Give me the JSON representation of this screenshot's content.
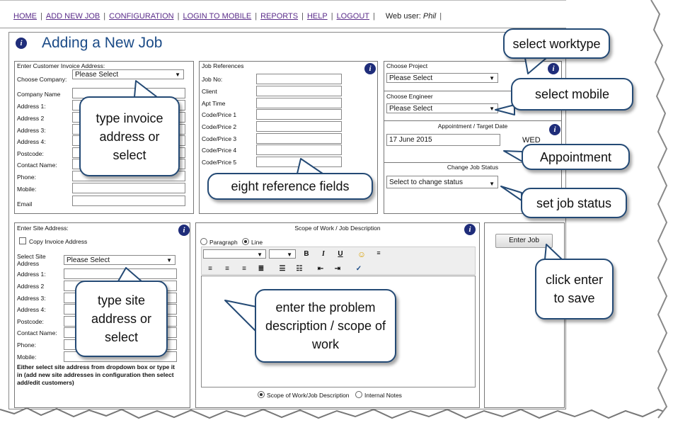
{
  "nav": {
    "items": [
      "HOME",
      "ADD NEW JOB",
      "CONFIGURATION",
      "LOGIN TO MOBILE",
      "REPORTS",
      "HELP",
      "LOGOUT"
    ],
    "web_user_label": "Web user:",
    "web_user_name": "Phil"
  },
  "page_title": "Adding a New Job",
  "invoice": {
    "heading": "Enter Customer Invoice Address:",
    "choose_company_label": "Choose Company:",
    "choose_company_value": "Please Select",
    "fields": [
      "Company Name",
      "Address 1:",
      "Address 2",
      "Address 3:",
      "Address 4:",
      "Postcode:",
      "Contact Name:",
      "Phone:",
      "Mobile:",
      "Email"
    ]
  },
  "jobrefs": {
    "heading": "Job References",
    "fields": [
      "Job No:",
      "Client",
      "Apt Time",
      "Code/Price 1",
      "Code/Price 2",
      "Code/Price 3",
      "Code/Price 4",
      "Code/Price 5"
    ]
  },
  "project": {
    "heading": "Choose Project",
    "value": "Please Select"
  },
  "engineer": {
    "heading": "Choose Engineer",
    "value": "Please Select"
  },
  "appointment": {
    "heading": "Appointment / Target Date",
    "date": "17 June 2015",
    "day": "WED"
  },
  "status": {
    "heading": "Change Job Status",
    "value": "Select to change status"
  },
  "site": {
    "heading": "Enter Site Address:",
    "copy_label": "Copy Invoice Address",
    "select_label": "Select Site Address",
    "select_value": "Please Select",
    "fields": [
      "Address 1:",
      "Address 2",
      "Address 3:",
      "Address 4:",
      "Postcode:",
      "Contact Name:",
      "Phone:",
      "Mobile:"
    ],
    "note": "Either select site address from dropdown box or type it in (add new site addresses in configuration then select add/edit customers)"
  },
  "scope": {
    "heading": "Scope of Work / Job Description",
    "mode_paragraph": "Paragraph",
    "mode_line": "Line",
    "tab_scope": "Scope of Work/Job Description",
    "tab_notes": "Internal Notes"
  },
  "enter_job_label": "Enter Job",
  "callouts": {
    "worktype": "select worktype",
    "mobile": "select mobile",
    "appointment": "Appointment",
    "status": "set job status",
    "invoice": "type invoice address or select",
    "refs": "eight reference fields",
    "site": "type site address or select",
    "scope": "enter the problem description / scope of work",
    "save": "click enter to save"
  },
  "colors": {
    "title": "#1b4b87",
    "link": "#5b2d8a",
    "info_icon": "#1f2d7a",
    "bubble_border": "#244a75"
  }
}
